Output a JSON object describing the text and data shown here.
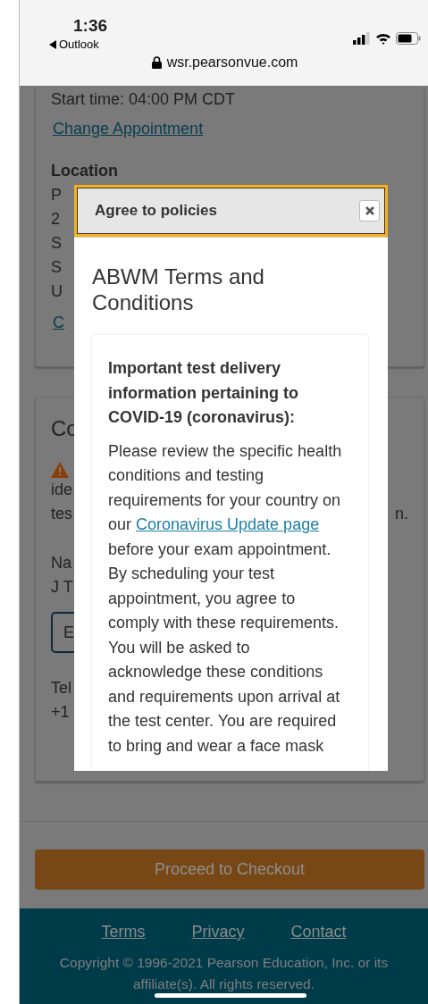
{
  "status_bar": {
    "time": "1:36",
    "back_label": "Outlook",
    "url": "wsr.pearsonvue.com"
  },
  "appointment_card": {
    "start_time": "Start time: 04:00 PM CDT",
    "change_link": "Change Appointment",
    "location_heading": "Location",
    "location_lines": [
      "P",
      "2",
      "S",
      "S",
      "U"
    ],
    "location_link": "C"
  },
  "contact_card": {
    "heading": "Co",
    "notice_lines": [
      "ide",
      "tes"
    ],
    "notice_end": "n.",
    "name_label": "Na",
    "name_value": "J T",
    "edit_button": "E",
    "phone_label": "Tel",
    "phone_value": "+1"
  },
  "checkout_button": "Proceed to Checkout",
  "footer": {
    "links": [
      "Terms",
      "Privacy",
      "Contact"
    ],
    "copyright": "Copyright © 1996-2021 Pearson Education, Inc. or its affiliate(s). All rights reserved."
  },
  "modal": {
    "title": "Agree to policies",
    "heading": "ABWM Terms and Conditions",
    "notice_heading": "Important test delivery information pertaining to COVID-19 (coronavirus):",
    "body_before": "Please review the specific health conditions and testing requirements for your country on our",
    "link": "Coronavirus Update page",
    "body_after": "before your exam appointment. By scheduling your test appointment, you agree to comply with these requirements. You will be asked to acknowledge these conditions and requirements upon arrival at the test center. You are required to bring and wear a face mask"
  }
}
